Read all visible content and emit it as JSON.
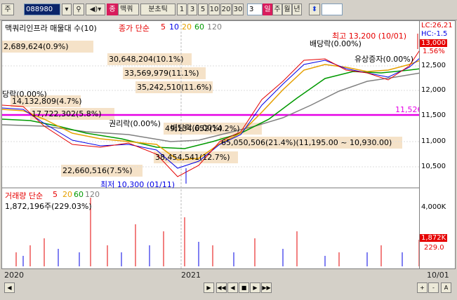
{
  "toolbar": {
    "label_main": "주",
    "stock_code": "088980",
    "stock_name": "맥쿼",
    "period_label": "분초틱",
    "periods": [
      "1",
      "3",
      "5",
      "10",
      "20",
      "30"
    ],
    "period_selected": "3",
    "day_btn": "일",
    "tabs": [
      "주",
      "월",
      "년"
    ],
    "search_icon": "magnifier-icon",
    "speaker_icon": "speaker-icon",
    "arrow_icon": "up-down-arrow-icon"
  },
  "price_panel": {
    "title": "맥쿼리인프라 매물대 수(10)",
    "ma_label": "종가 단순",
    "ma_periods": [
      "5",
      "10",
      "20",
      "60",
      "120"
    ],
    "ma_colors": [
      "#e60000",
      "#0000e6",
      "#e6a000",
      "#009900",
      "#808080"
    ],
    "high_label": "최고 13,200 (10/01)",
    "low_label": "최저 10,300 (01/11)",
    "hline_value": "11,526",
    "volume_profile": [
      "2,689,624(0.9%)",
      "30,648,204(10.1%)",
      "33,569,979(11.1%)",
      "35,242,510(11.6%)",
      "14,132,809(4.7%)",
      "17,722,302(5.8%)",
      "49,134,652(14.2%)",
      "38,454,541(12.7%)",
      "65,050,506(21.4%)(11,195.00 ~ 10,930.00)",
      "22,660,516(7.5%)"
    ],
    "events": [
      "배당락(0.00%)",
      "권리락(0.00%)",
      "배당락(0.00%)",
      "유상증자(0.00%)",
      "배당락(0.00%)",
      "유상증자(0.00%)",
      "당락(0.00%)"
    ]
  },
  "right_axis": {
    "lc": "LC:26,21",
    "hc": "HC:-1.5",
    "current_price": "13,000",
    "change_pct": "1.56%",
    "ticks": [
      "12,500",
      "12,000",
      "11,500",
      "11,000",
      "10,500"
    ],
    "vol_ticks": [
      "4,000K"
    ],
    "vol_current": "1,872K",
    "vol_value2": "229.0"
  },
  "volume_panel": {
    "title": "거래량 단순",
    "ma_periods": [
      "5",
      "20",
      "60",
      "120"
    ],
    "ma_colors": [
      "#e60000",
      "#e6a000",
      "#009900",
      "#808080"
    ],
    "current": "1,872,196주(229.03%)"
  },
  "x_axis": {
    "labels": [
      "2020",
      "2021",
      "10/01"
    ]
  },
  "bottom_nav": {
    "buttons": [
      "◀",
      "▶",
      "◀◀",
      "◀",
      "■",
      "▶",
      "▶▶",
      "+",
      "-",
      "A"
    ]
  }
}
